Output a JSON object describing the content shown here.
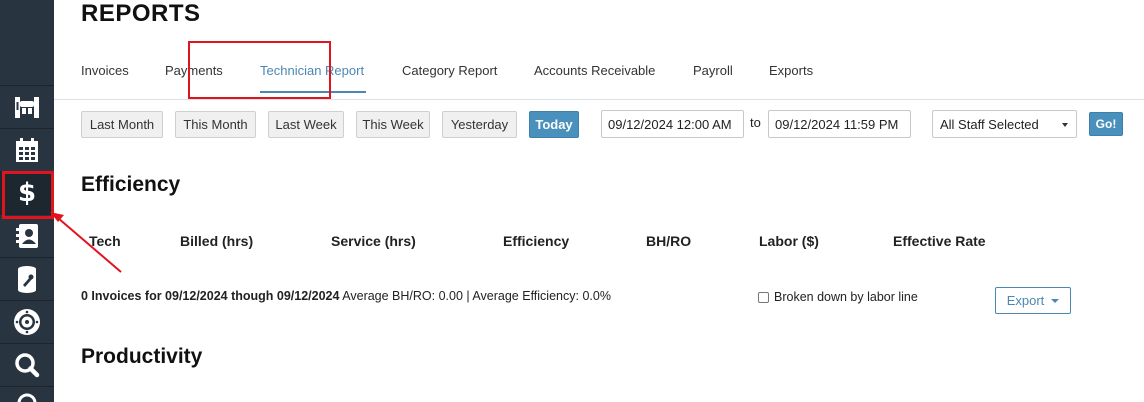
{
  "page": {
    "title": "REPORTS"
  },
  "sidebar": {
    "items": [
      {
        "icon": "car-lift-icon"
      },
      {
        "icon": "calendar-icon"
      },
      {
        "icon": "dollar-icon",
        "label": "$",
        "active": true
      },
      {
        "icon": "contacts-icon"
      },
      {
        "icon": "parts-icon"
      },
      {
        "icon": "tire-icon"
      },
      {
        "icon": "search-icon"
      }
    ]
  },
  "tabs": [
    {
      "label": "Invoices"
    },
    {
      "label": "Payments"
    },
    {
      "label": "Technician Report",
      "active": true
    },
    {
      "label": "Category Report"
    },
    {
      "label": "Accounts Receivable"
    },
    {
      "label": "Payroll"
    },
    {
      "label": "Exports"
    }
  ],
  "filters": {
    "range_buttons": [
      "Last Month",
      "This Month",
      "Last Week",
      "This Week",
      "Yesterday",
      "Today"
    ],
    "from_date": "09/12/2024 12:00 AM",
    "to_label": "to",
    "to_date": "09/12/2024 11:59 PM",
    "staff_selected": "All Staff Selected",
    "go_label": "Go!"
  },
  "efficiency": {
    "title": "Efficiency",
    "columns": [
      "Tech",
      "Billed (hrs)",
      "Service (hrs)",
      "Efficiency",
      "BH/RO",
      "Labor ($)",
      "Effective Rate"
    ],
    "summary_bold": "0 Invoices for 09/12/2024 though 09/12/2024",
    "summary_rest": " Average BH/RO: 0.00 | Average Efficiency: 0.0%",
    "breakdown_label": "Broken down by labor line",
    "export_label": "Export"
  },
  "productivity": {
    "title": "Productivity"
  },
  "colors": {
    "accent": "#4a88b3",
    "sidebar": "#28343f",
    "highlight": "#e0141e"
  }
}
